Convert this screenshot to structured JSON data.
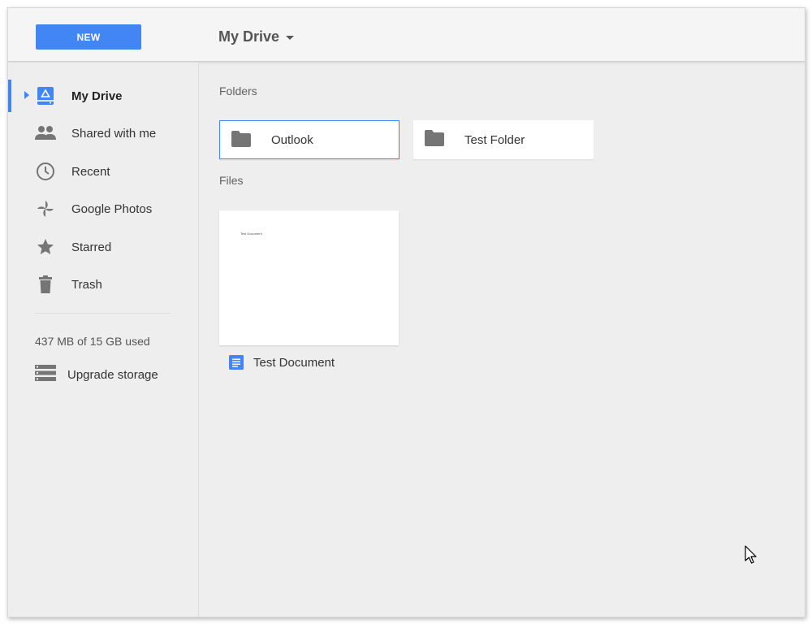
{
  "header": {
    "new_label": "NEW",
    "title": "My Drive"
  },
  "sidebar": {
    "items": [
      {
        "label": "My Drive",
        "icon": "my-drive-icon",
        "active": true
      },
      {
        "label": "Shared with me",
        "icon": "people-icon"
      },
      {
        "label": "Recent",
        "icon": "clock-icon"
      },
      {
        "label": "Google Photos",
        "icon": "pinwheel-icon"
      },
      {
        "label": "Starred",
        "icon": "star-icon"
      },
      {
        "label": "Trash",
        "icon": "trash-icon"
      }
    ],
    "storage_used": "437 MB of 15 GB used",
    "upgrade_label": "Upgrade storage"
  },
  "main": {
    "folders_label": "Folders",
    "folders": [
      {
        "name": "Outlook",
        "selected": true
      },
      {
        "name": "Test Folder",
        "selected": false
      }
    ],
    "files_label": "Files",
    "files": [
      {
        "name": "Test Document",
        "thumb_text": "Test Document",
        "icon": "google-docs-icon"
      }
    ]
  },
  "colors": {
    "accent": "#4285f4",
    "icon_gray": "#757575",
    "background": "#eeeeee"
  }
}
